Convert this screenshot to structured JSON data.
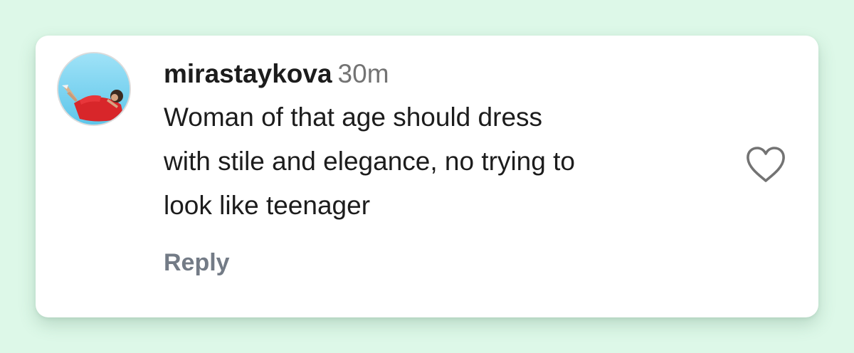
{
  "comment": {
    "username": "mirastaykova",
    "timestamp": "30m",
    "text_lines": [
      "Woman of that age should dress",
      "with stile and elegance, no trying to",
      "look like teenager"
    ],
    "reply_label": "Reply"
  },
  "icons": {
    "like": "heart-outline-icon",
    "avatar": "user-avatar"
  },
  "colors": {
    "page_background": "#ddf8e8",
    "card_background": "#ffffff",
    "text_primary": "#1c1c1c",
    "text_secondary": "#737373",
    "reply_color": "#737b86",
    "heart_stroke": "#737373"
  }
}
